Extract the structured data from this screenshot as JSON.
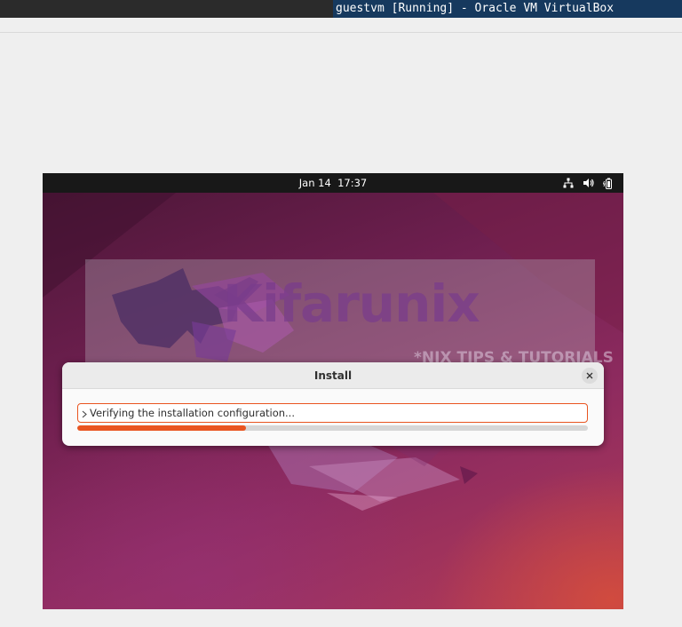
{
  "host_window": {
    "title": "guestvm [Running] - Oracle VM VirtualBox"
  },
  "vm_topbar": {
    "date": "Jan 14",
    "time": "17:37",
    "icons": [
      "network-icon",
      "volume-icon",
      "battery-icon"
    ]
  },
  "watermark": {
    "brand": "Kifarunix",
    "tagline": "*NIX TIPS & TUTORIALS"
  },
  "install_dialog": {
    "title": "Install",
    "status_text": "Verifying the installation configuration...",
    "progress": 0.33
  },
  "colors": {
    "accent": "#e95420",
    "host_title_bg": "#16395e",
    "topbar_bg": "#181818"
  }
}
